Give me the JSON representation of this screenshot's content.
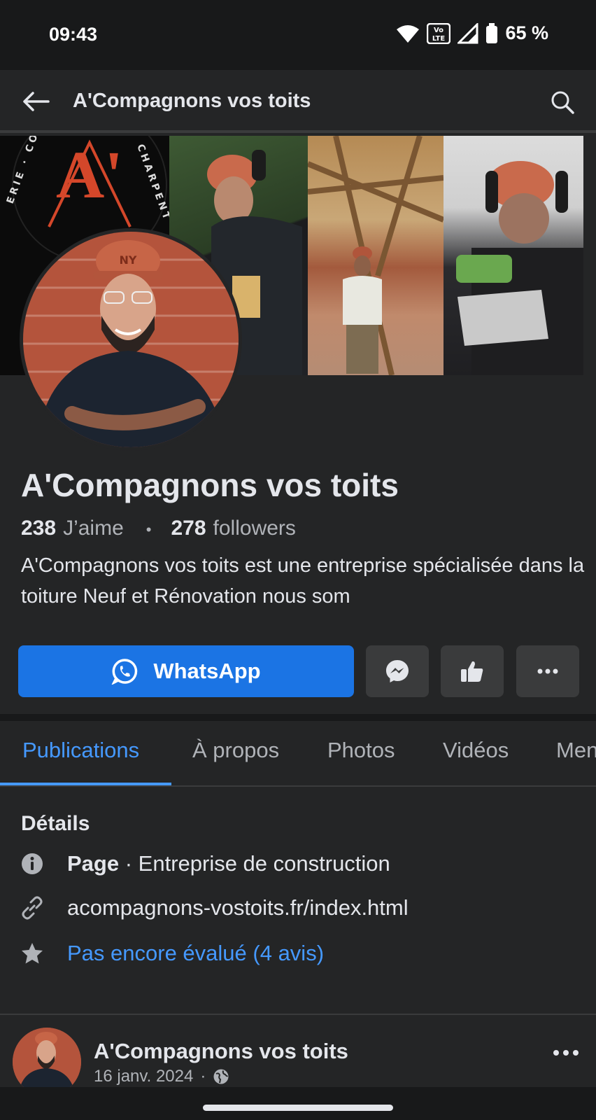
{
  "status_bar": {
    "time": "09:43",
    "network": "Vo LTE",
    "battery": "65 %"
  },
  "nav": {
    "title": "A'Compagnons vos toits",
    "back_icon": "arrow-left-icon",
    "search_icon": "search-icon"
  },
  "cover": {
    "logo_letters": "A'",
    "logo_ring_text": "COUVERTURE CHARPENTE ZINGUERIE",
    "cap_logo": "NY"
  },
  "profile": {
    "name": "A'Compagnons vos toits",
    "likes_count": "238",
    "likes_label": "J’aime",
    "separator": "•",
    "followers_count": "278",
    "followers_label": "followers",
    "bio": "A'Compagnons vos toits est une entreprise spécialisée dans la toiture Neuf et Rénovation nous som"
  },
  "actions": {
    "whatsapp_label": "WhatsApp"
  },
  "tabs": [
    {
      "label": "Publications",
      "active": true
    },
    {
      "label": "À propos",
      "active": false
    },
    {
      "label": "Photos",
      "active": false
    },
    {
      "label": "Vidéos",
      "active": false
    },
    {
      "label": "Mentions",
      "active": false
    }
  ],
  "details": {
    "title": "Détails",
    "category_prefix": "Page",
    "category": " · Entreprise de construction",
    "website": "acompagnons-vostoits.fr/index.html",
    "rating": "Pas encore évalué (4 avis)"
  },
  "post": {
    "author": "A'Compagnons vos toits",
    "date": "16 janv. 2024",
    "date_separator": "·"
  },
  "colors": {
    "accent": "#1b74e4",
    "link": "#4599ff",
    "background": "#242526"
  }
}
